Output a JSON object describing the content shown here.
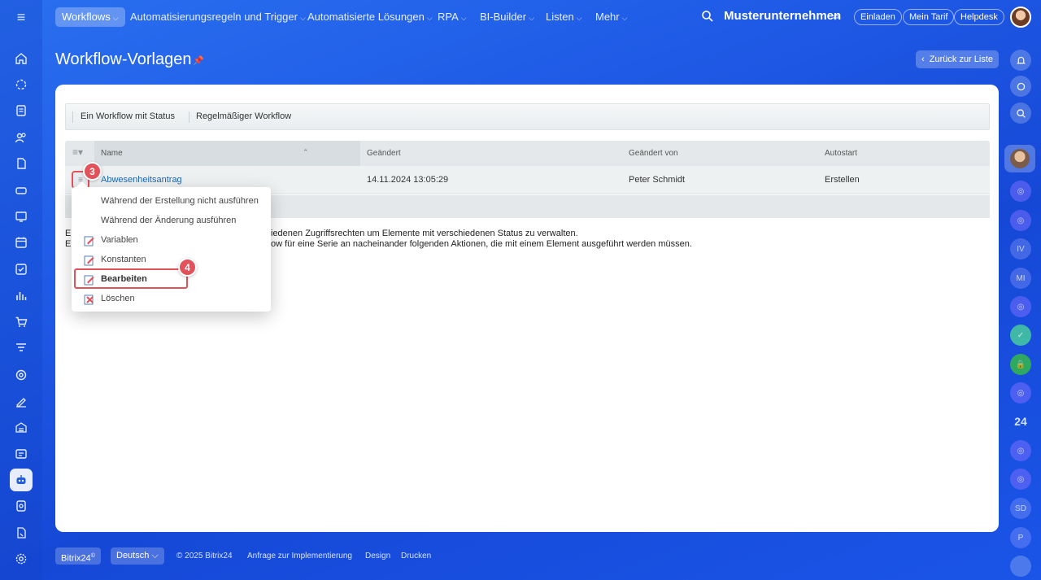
{
  "topnav": {
    "items": [
      {
        "label": "Workflows",
        "active": true
      },
      {
        "label": "Automatisierungsregeln und Trigger"
      },
      {
        "label": "Automatisierte Lösungen"
      },
      {
        "label": "RPA"
      },
      {
        "label": "BI-Builder"
      },
      {
        "label": "Listen"
      },
      {
        "label": "Mehr"
      }
    ],
    "company": "Musterunternehmen",
    "invite": "Einladen",
    "tariff": "Mein Tarif",
    "helpdesk": "Helpdesk"
  },
  "page": {
    "title": "Workflow-Vorlagen",
    "back_button": "Zurück zur Liste"
  },
  "toolbar": {
    "tab1": "Ein Workflow mit Status",
    "tab2": "Regelmäßiger Workflow"
  },
  "grid": {
    "columns": [
      "Name",
      "Geändert",
      "Geändert von",
      "Autostart"
    ],
    "rows": [
      {
        "name": "Abwesenheitsantrag",
        "changed": "14.11.2024 13:05:29",
        "changed_by": "Peter Schmidt",
        "autostart": "Erstellen"
      }
    ]
  },
  "description": {
    "line1_start": "Ei",
    "line1_end": "iedenen Zugriffsrechten um Elemente mit verschiedenen Status zu verwalten.",
    "line2_start": "Ei",
    "line2_end": "ow für eine Serie an nacheinander folgenden Aktionen, die mit einem Element ausgeführt werden müssen."
  },
  "context_menu": {
    "items": [
      {
        "label": "Während der Erstellung nicht ausführen"
      },
      {
        "label": "Während der Änderung ausführen"
      },
      {
        "label": "Variablen"
      },
      {
        "label": "Konstanten"
      },
      {
        "label": "Bearbeiten"
      },
      {
        "label": "Löschen"
      }
    ]
  },
  "badges": {
    "step3": "3",
    "step4": "4"
  },
  "right_bar": {
    "apps_label": "24",
    "iv": "IV",
    "mi": "MI",
    "sd": "SD",
    "p": "P"
  },
  "footer": {
    "brand": "Bitrix24",
    "language": "Deutsch",
    "copyright": "© 2025 Bitrix24",
    "link1": "Anfrage zur Implementierung",
    "link2": "Design",
    "link3": "Drucken"
  },
  "colors": {
    "accent": "#2067b0",
    "highlight": "#e2525a",
    "background": "#1f5be6"
  }
}
